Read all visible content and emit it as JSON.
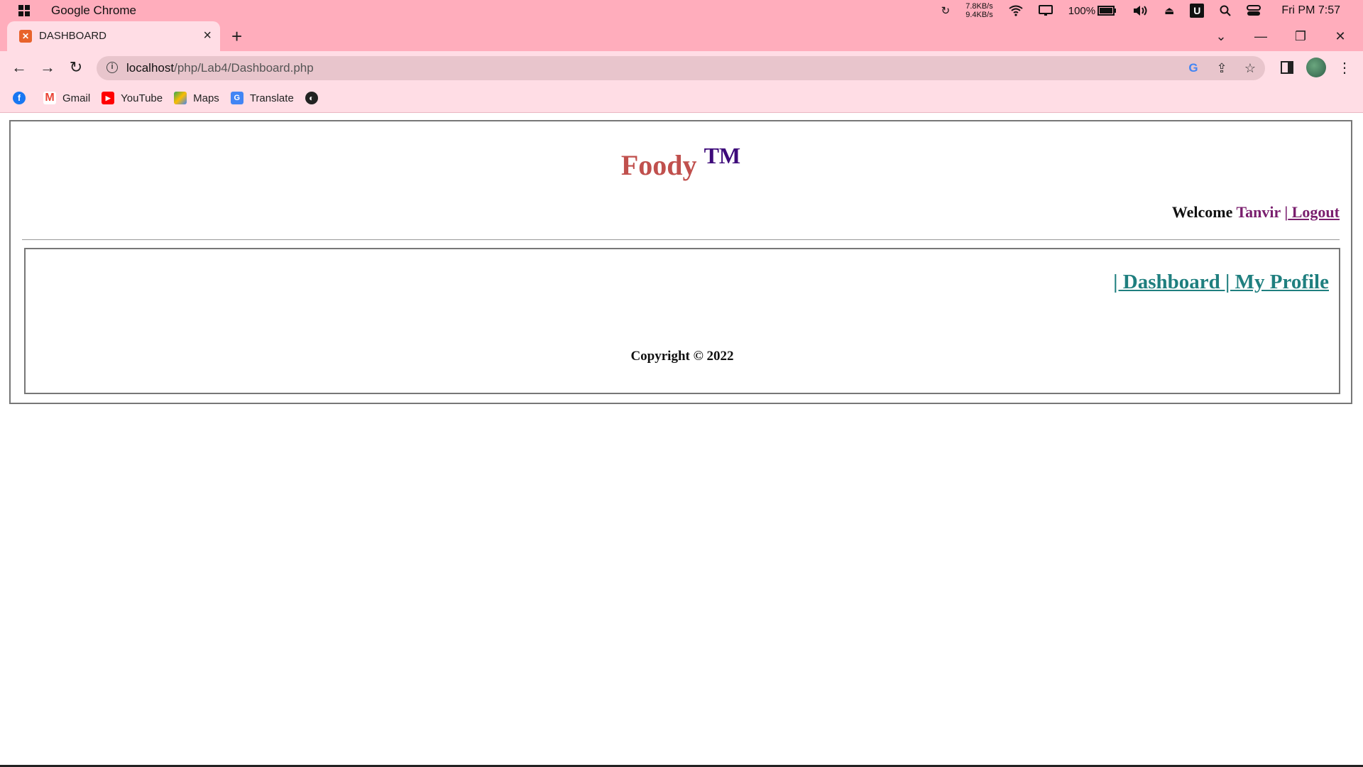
{
  "os": {
    "app_title": "Google Chrome",
    "net_up": "7.8KB/s",
    "net_down": "9.4KB/s",
    "battery": "100%",
    "clock": "Fri PM 7:57"
  },
  "browser": {
    "tab_title": "DASHBOARD",
    "url_host": "localhost",
    "url_path": "/php/Lab4/Dashboard.php",
    "bookmarks": [
      {
        "label": "Gmail"
      },
      {
        "label": "YouTube"
      },
      {
        "label": "Maps"
      },
      {
        "label": "Translate"
      }
    ]
  },
  "page": {
    "brand": "Foody",
    "brand_tm": "TM",
    "welcome_prefix": "Welcome",
    "username": "Tanvir",
    "logout_sep": "|",
    "logout_label": " Logout",
    "menu_text": "| Dashboard | My Profile",
    "copyright": "Copyright © 2022"
  }
}
